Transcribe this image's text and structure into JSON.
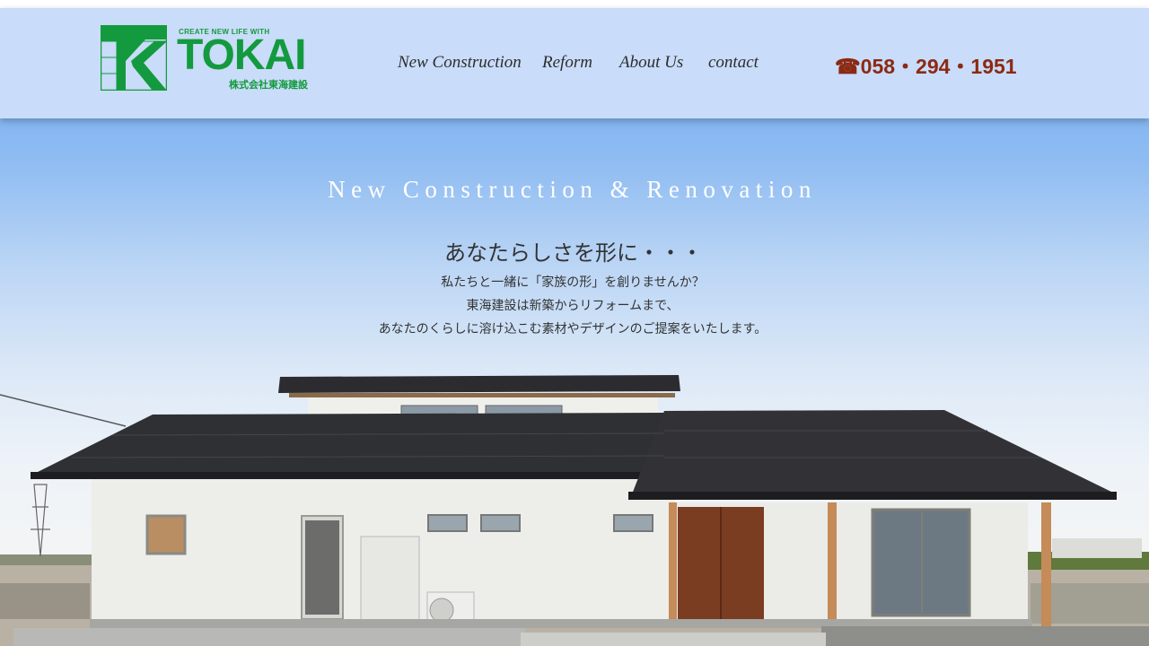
{
  "header": {
    "logo": {
      "tagline": "CREATE NEW LIFE WITH",
      "name": "TOKAI",
      "company": "株式会社東海建設"
    },
    "nav": [
      {
        "label": "New Construction"
      },
      {
        "label": "Reform"
      },
      {
        "label": "About Us"
      },
      {
        "label": "contact"
      }
    ],
    "phone": "☎058・294・1951"
  },
  "hero": {
    "title": "New Construction & Renovation",
    "heading": "あなたらしさを形に・・・",
    "lines": [
      "私たちと一緒に「家族の形」を創りませんか？",
      "東海建設は新築からリフォームまで、",
      "あなたのくらしに溶け込こむ素材やデザインのご提案をいたします。"
    ]
  },
  "colors": {
    "brand_green": "#149a3e",
    "header_bg": "#c9dcf9",
    "phone": "#8b2a13"
  }
}
